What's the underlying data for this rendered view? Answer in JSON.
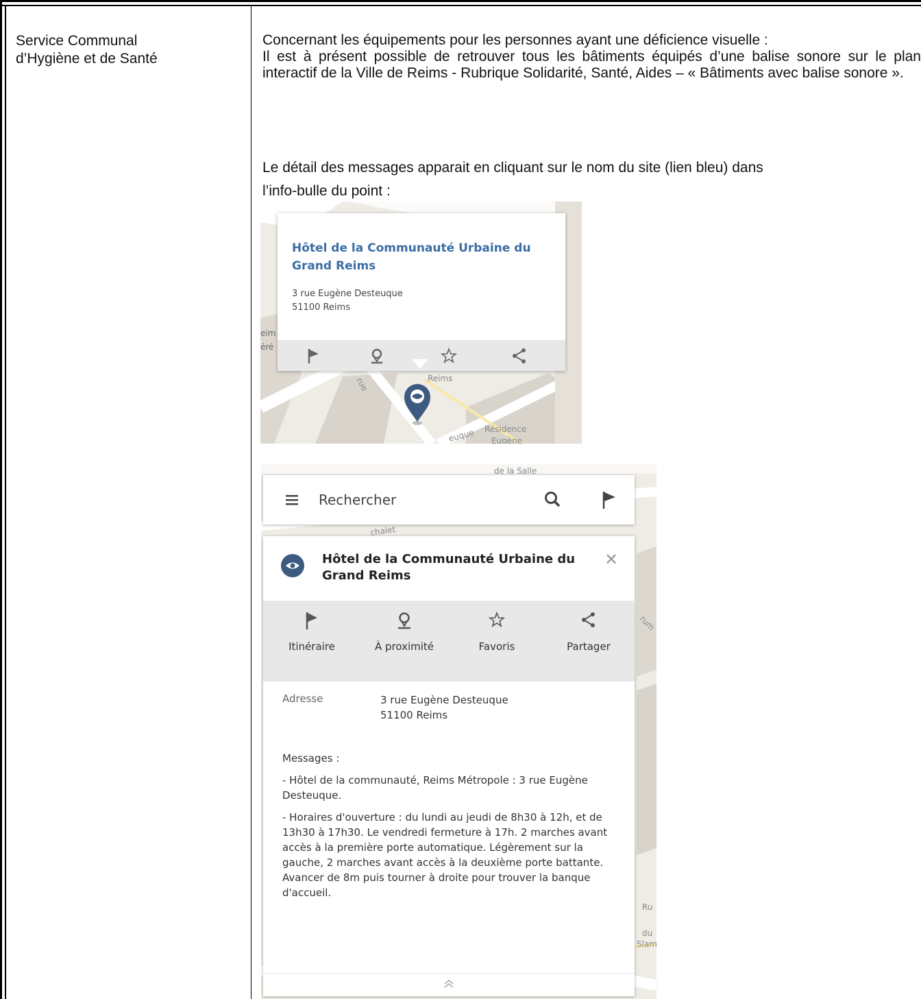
{
  "left_cell": {
    "line1": "Service Communal",
    "line2": "d’Hygiène et de Santé"
  },
  "right_cell": {
    "p1_line1": "Concernant les équipements pour les personnes ayant une déficience visuelle :",
    "p1_body": "Il est à présent possible de retrouver tous les bâtiments équipés d’une balise sonore sur le plan interactif de la Ville de Reims - Rubrique Solidarité, Santé, Aides – « Bâtiments avec balise sonore ».",
    "p2_line1": "Le détail des messages apparait en cliquant sur le nom du site (lien bleu) dans",
    "p2_line2": "l’info-bulle du point :"
  },
  "screenshot1": {
    "title": "Hôtel de la Communauté Urbaine du Grand Reims",
    "address_line1": "3 rue Eugène Desteuque",
    "address_line2": "51100 Reims",
    "map_labels": [
      "Reims",
      "Résidence",
      "Eugène",
      "eim",
      "éré",
      "rue",
      "euque"
    ]
  },
  "screenshot2": {
    "search_placeholder": "Rechercher",
    "title": "Hôtel de la Communauté Urbaine du Grand Reims",
    "actions": [
      "Itinéraire",
      "À proximité",
      "Favoris",
      "Partager"
    ],
    "address_label": "Adresse",
    "address_line1": "3 rue Eugène Desteuque",
    "address_line2": "51100 Reims",
    "messages_heading": "Messages :",
    "message1": "- Hôtel de la communauté, Reims Métropole : 3 rue Eugène Desteuque.",
    "message2": "- Horaires d'ouverture : du lundi au jeudi de 8h30 à 12h, et de 13h30 à 17h30. Le vendredi fermeture à 17h. 2 marches avant accès à la première porte automatique. Légèrement sur la gauche, 2 marches avant accès à la deuxième porte battante. Avancer de 8m puis tourner à droite pour trouver la banque d'accueil.",
    "map_labels": [
      "chalet",
      "Ru",
      "du",
      "Slam",
      "rum",
      "de la Salle"
    ]
  },
  "colors": {
    "link_blue": "#3b6da3",
    "marker_blue": "#3d5a80",
    "map_bg": "#efece6",
    "bar_grey": "#e8e8e8"
  }
}
